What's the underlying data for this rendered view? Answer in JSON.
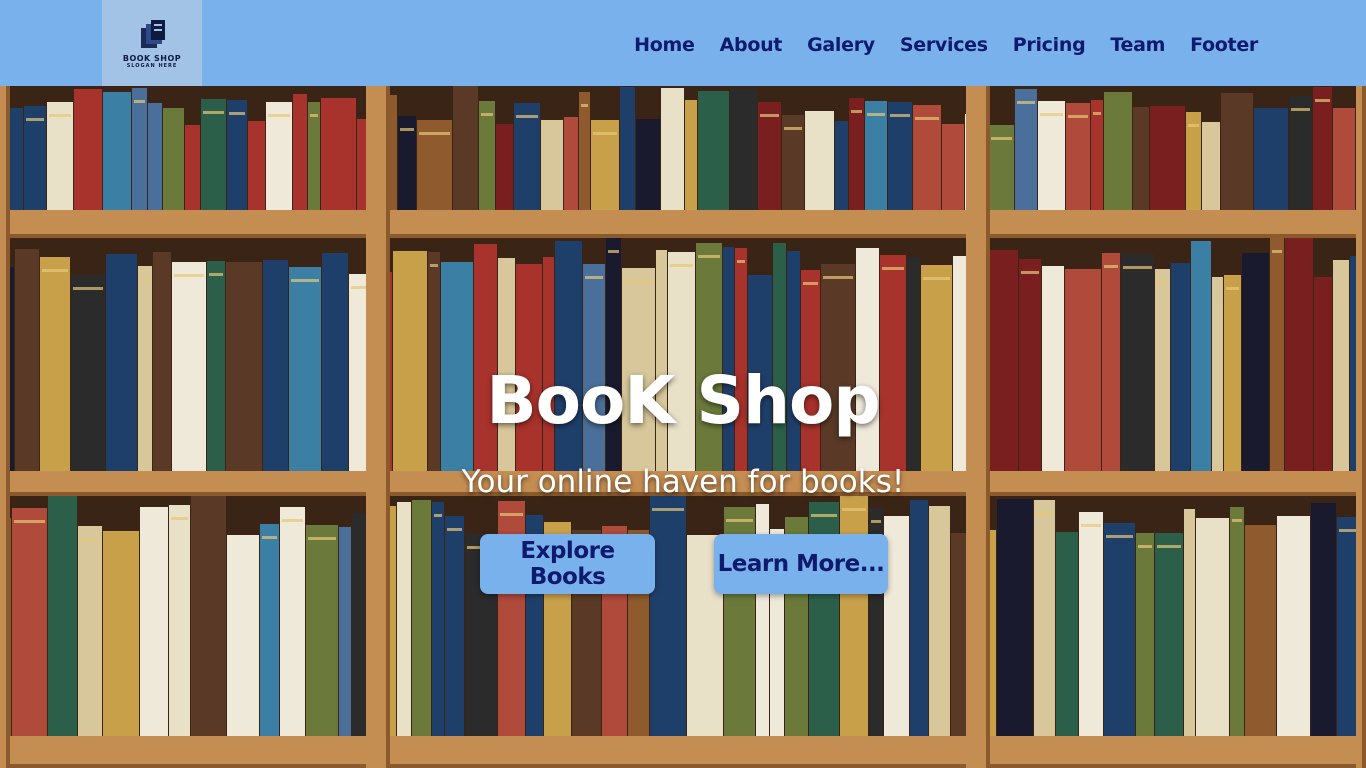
{
  "brand": {
    "name": "BOOK SHOP",
    "slogan": "SLOGAN HERE",
    "logo_icon": "books-stack-icon"
  },
  "nav": {
    "items": [
      {
        "label": "Home"
      },
      {
        "label": "About"
      },
      {
        "label": "Galery"
      },
      {
        "label": "Services"
      },
      {
        "label": "Pricing"
      },
      {
        "label": "Team"
      },
      {
        "label": "Footer"
      }
    ]
  },
  "hero": {
    "title": "BooK Shop",
    "subtitle": "Your online haven for books!",
    "background": "bookshelf-photo",
    "buttons": {
      "explore_label": "Explore Books",
      "learn_label": "Learn More..."
    }
  },
  "colors": {
    "navbar": "#78b1ec",
    "logo_bg": "#a3c3e6",
    "nav_text": "#0f1a6e",
    "button_bg": "#78b1ec",
    "button_text": "#0f1a6e",
    "hero_text": "#ffffff"
  }
}
